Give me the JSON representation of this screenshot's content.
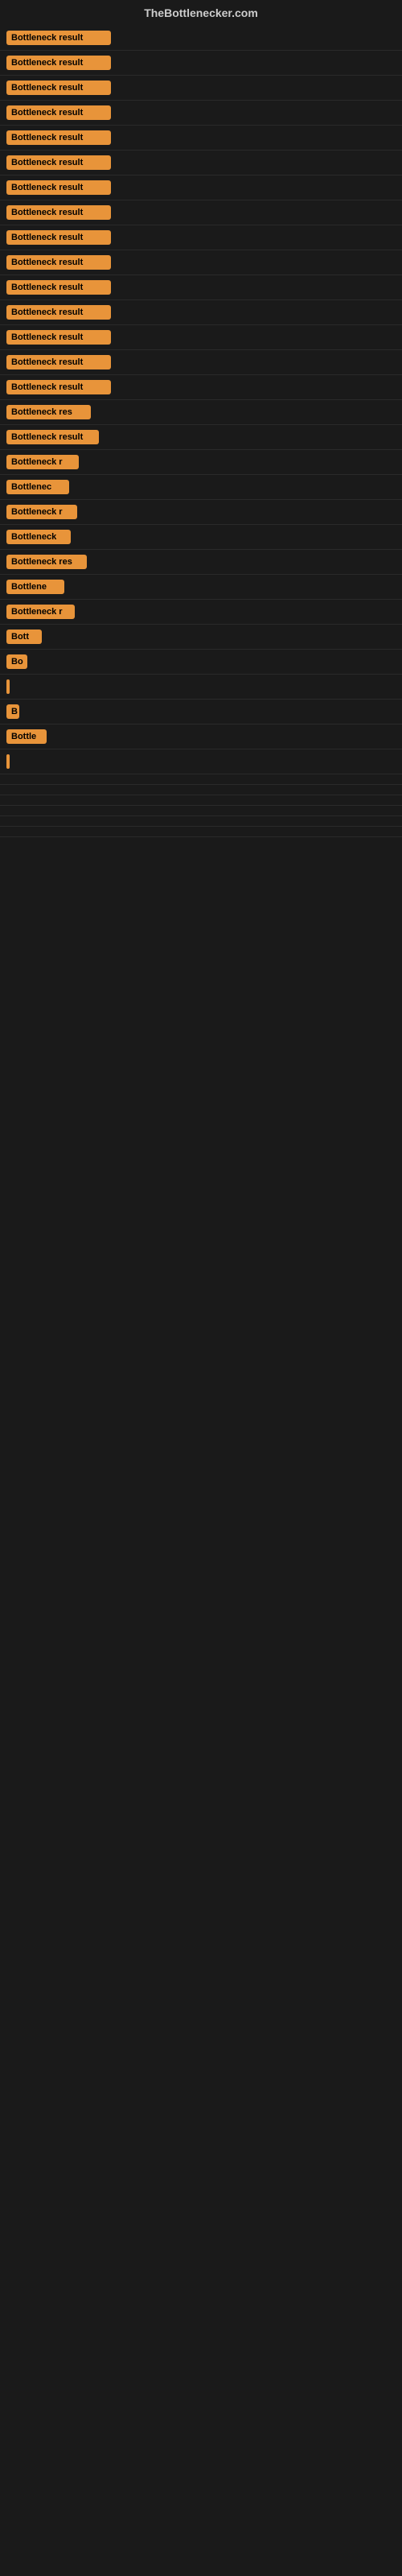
{
  "header": {
    "title": "TheBottlenecker.com"
  },
  "items": [
    {
      "label": "Bottleneck result",
      "width": 130
    },
    {
      "label": "Bottleneck result",
      "width": 130
    },
    {
      "label": "Bottleneck result",
      "width": 130
    },
    {
      "label": "Bottleneck result",
      "width": 130
    },
    {
      "label": "Bottleneck result",
      "width": 130
    },
    {
      "label": "Bottleneck result",
      "width": 130
    },
    {
      "label": "Bottleneck result",
      "width": 130
    },
    {
      "label": "Bottleneck result",
      "width": 130
    },
    {
      "label": "Bottleneck result",
      "width": 130
    },
    {
      "label": "Bottleneck result",
      "width": 130
    },
    {
      "label": "Bottleneck result",
      "width": 130
    },
    {
      "label": "Bottleneck result",
      "width": 130
    },
    {
      "label": "Bottleneck result",
      "width": 130
    },
    {
      "label": "Bottleneck result",
      "width": 130
    },
    {
      "label": "Bottleneck result",
      "width": 130
    },
    {
      "label": "Bottleneck res",
      "width": 105
    },
    {
      "label": "Bottleneck result",
      "width": 115
    },
    {
      "label": "Bottleneck r",
      "width": 90
    },
    {
      "label": "Bottlenec",
      "width": 78
    },
    {
      "label": "Bottleneck r",
      "width": 88
    },
    {
      "label": "Bottleneck",
      "width": 80
    },
    {
      "label": "Bottleneck res",
      "width": 100
    },
    {
      "label": "Bottlene",
      "width": 72
    },
    {
      "label": "Bottleneck r",
      "width": 85
    },
    {
      "label": "Bott",
      "width": 44
    },
    {
      "label": "Bo",
      "width": 26
    },
    {
      "label": "|",
      "width": 8
    },
    {
      "label": "B",
      "width": 16
    },
    {
      "label": "Bottle",
      "width": 50
    },
    {
      "label": "|",
      "width": 8
    },
    {
      "label": "",
      "width": 0
    },
    {
      "label": "",
      "width": 0
    },
    {
      "label": "",
      "width": 0
    },
    {
      "label": "",
      "width": 0
    },
    {
      "label": "",
      "width": 0
    },
    {
      "label": "",
      "width": 0
    }
  ]
}
